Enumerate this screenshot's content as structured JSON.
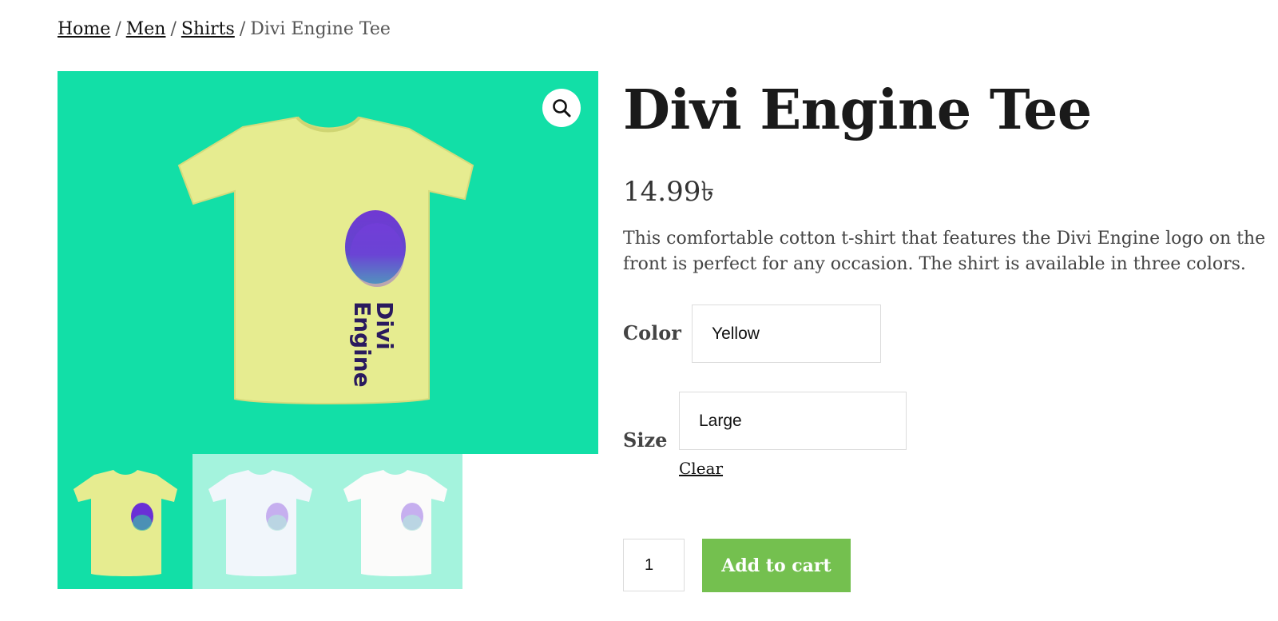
{
  "breadcrumb": {
    "items": [
      {
        "label": "Home"
      },
      {
        "label": "Men"
      },
      {
        "label": "Shirts"
      }
    ],
    "current": "Divi Engine Tee",
    "separator": "/"
  },
  "product": {
    "title": "Divi Engine Tee",
    "price": "14.99৳",
    "description": "This comfortable cotton t-shirt that features the Divi Engine logo on the front is perfect for any occasion. The shirt is available in three colors.",
    "image_background": "#12dfa7",
    "logo_text_line1": "Divi",
    "logo_text_line2": "Engine"
  },
  "variations": {
    "color_label": "Color",
    "color_value": "Yellow",
    "size_label": "Size",
    "size_value": "Large",
    "clear_label": "Clear"
  },
  "thumbnails": [
    {
      "shirt_color": "#e6ec90",
      "selected": true
    },
    {
      "shirt_color": "#dbe8f4",
      "selected": false
    },
    {
      "shirt_color": "#f4f4f2",
      "selected": false
    }
  ],
  "cart": {
    "quantity": "1",
    "add_label": "Add to cart",
    "button_color": "#74c04f"
  },
  "icons": {
    "zoom": "magnifier-icon"
  }
}
